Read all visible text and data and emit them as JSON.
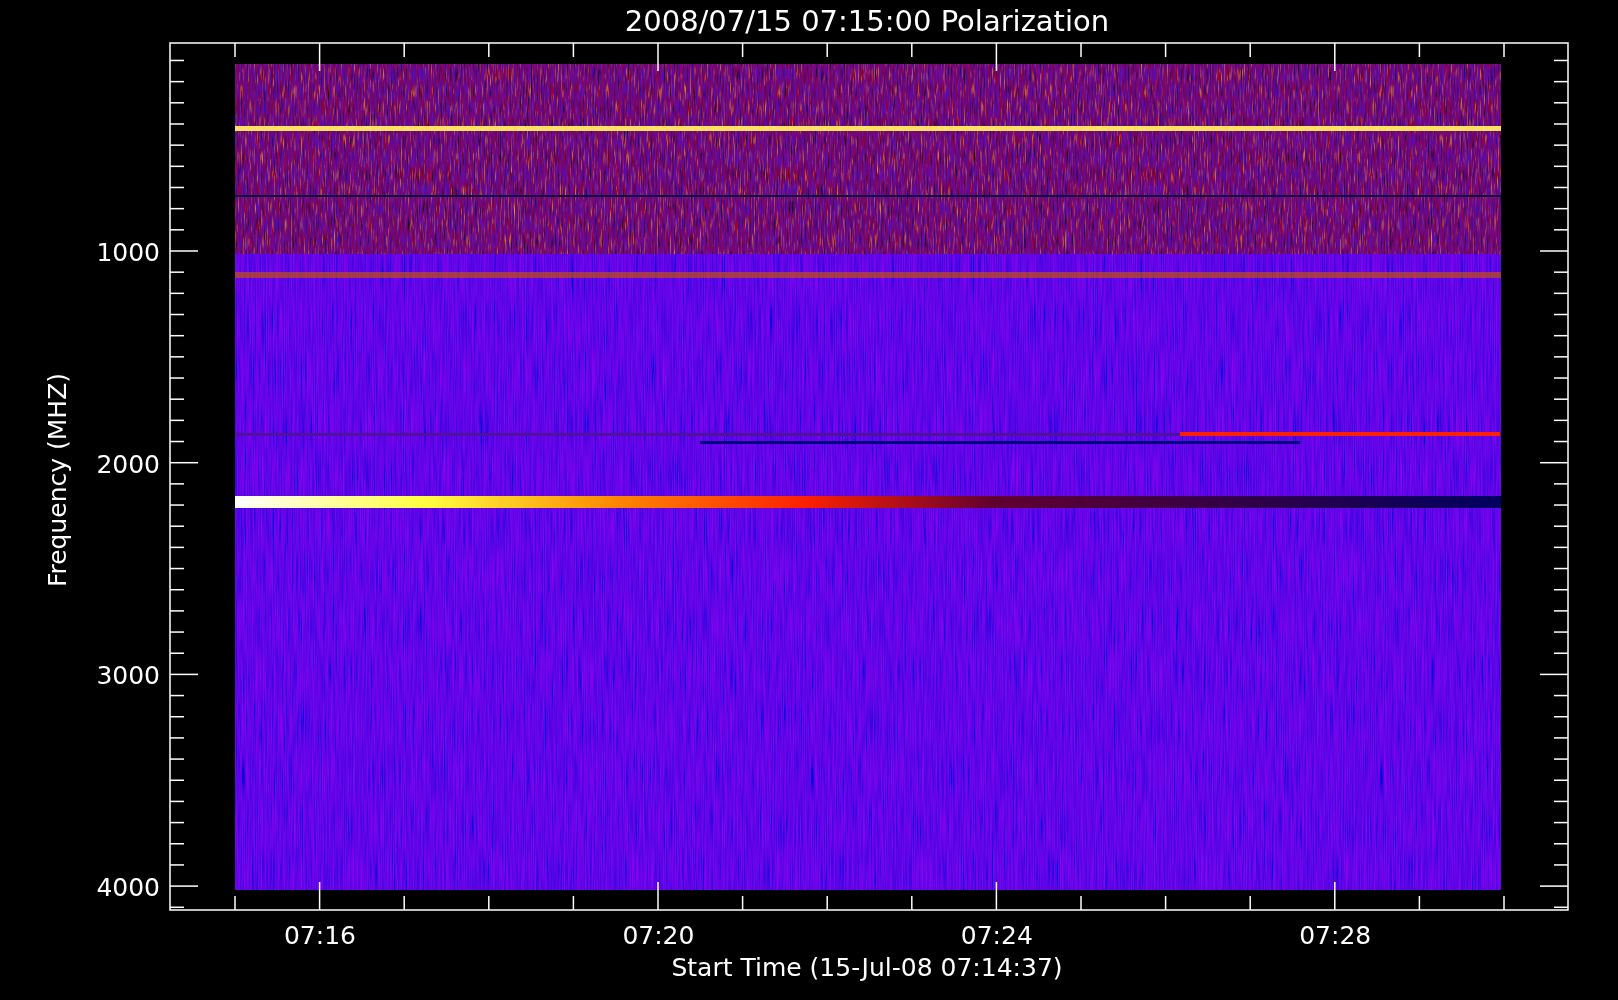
{
  "plot": {
    "title": "2008/07/15 07:15:00 Polarization",
    "ylabel": "Frequency (MHZ)",
    "xlabel": "Start Time (15-Jul-08 07:14:37)",
    "yticks": [
      "1000",
      "2000",
      "3000",
      "4000"
    ],
    "xticks": [
      "07:16",
      "07:20",
      "07:24",
      "07:28"
    ]
  }
}
